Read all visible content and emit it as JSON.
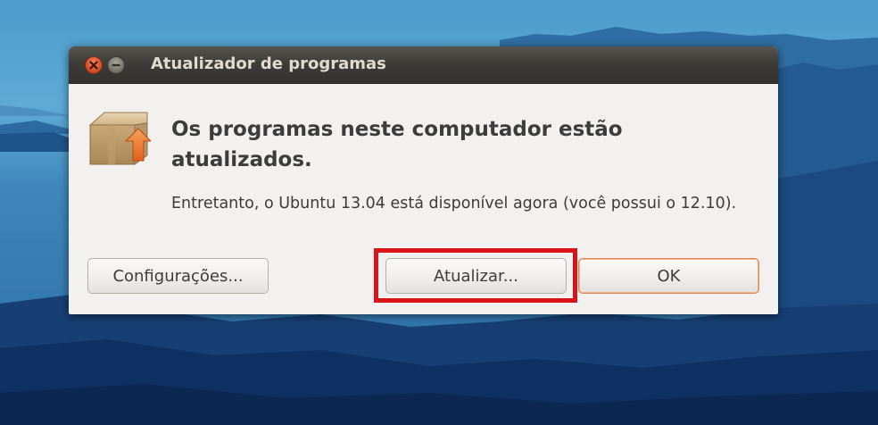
{
  "window": {
    "title": "Atualizador de programas",
    "close_icon": "close-icon",
    "minimize_icon": "minimize-icon"
  },
  "dialog": {
    "icon": "software-update-package-icon",
    "heading": "Os programas neste computador estão atualizados.",
    "message": "Entretanto, o Ubuntu 13.04 está disponível agora (você possui o 12.10)."
  },
  "buttons": {
    "settings_label": "Configurações...",
    "upgrade_label": "Atualizar...",
    "ok_label": "OK"
  },
  "colors": {
    "highlight": "#d8141a",
    "titlebar": "#3d3b37",
    "dialog_bg": "#f2f1f0",
    "close_button": "#e15a35",
    "default_button_border": "#e0884f"
  }
}
